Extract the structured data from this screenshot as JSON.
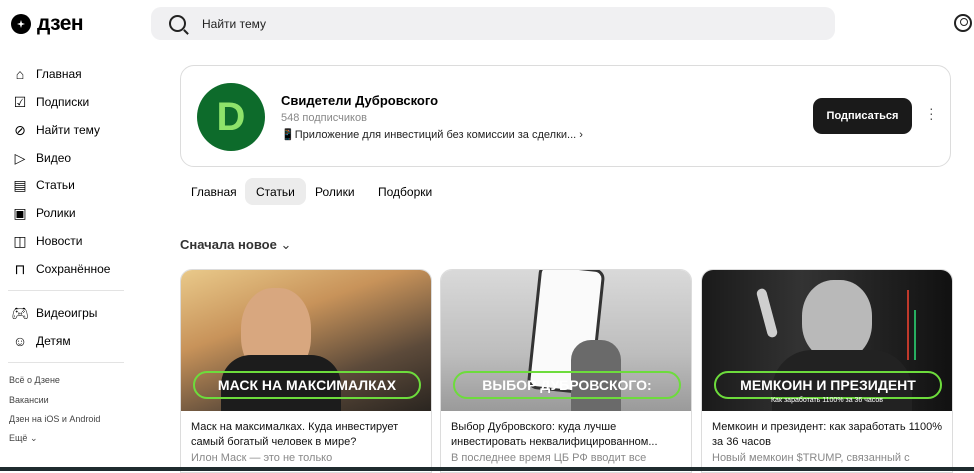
{
  "header": {
    "logo_text": "дзен",
    "search_placeholder": "Найти тему"
  },
  "sidebar": {
    "items": [
      {
        "label": "Главная",
        "icon": "home-icon"
      },
      {
        "label": "Подписки",
        "icon": "subscriptions-icon"
      },
      {
        "label": "Найти тему",
        "icon": "find-topic-icon"
      },
      {
        "label": "Видео",
        "icon": "video-icon"
      },
      {
        "label": "Статьи",
        "icon": "articles-icon"
      },
      {
        "label": "Ролики",
        "icon": "shorts-icon"
      },
      {
        "label": "Новости",
        "icon": "news-icon"
      },
      {
        "label": "Сохранённое",
        "icon": "bookmark-icon"
      }
    ],
    "extra_items": [
      {
        "label": "Видеоигры",
        "icon": "gamepad-icon"
      },
      {
        "label": "Детям",
        "icon": "kids-icon"
      }
    ],
    "footer_links": [
      "Всё о Дзене",
      "Вакансии",
      "Дзен на iOS и Android",
      "Ещё"
    ]
  },
  "channel": {
    "title": "Свидетели Дубровского",
    "subscribers": "548 подписчиков",
    "description": "📱Приложение для инвестиций без комиссии за сделки...",
    "subscribe_label": "Подписаться",
    "avatar_letter": "D"
  },
  "tabs": [
    "Главная",
    "Статьи",
    "Ролики",
    "Подборки"
  ],
  "active_tab": "Статьи",
  "sort_label": "Сначала новое",
  "cards": [
    {
      "badge": "МАСК НА МАКСИМАЛКАХ",
      "title": "Маск на максималках. Куда инвестирует самый богатый человек в мире?",
      "snippet": "Илон Маск — это не только"
    },
    {
      "badge": "ВЫБОР ДУБРОВСКОГО:",
      "title": "Выбор Дубровского: куда лучше инвестировать неквалифицированном...",
      "snippet": "В последнее время ЦБ РФ вводит все"
    },
    {
      "badge": "МЕМКОИН И ПРЕЗИДЕНТ",
      "title": "Мемкоин и президент: как заработать 1100% за 36 часов",
      "snippet": "Новый мемкоин $TRUMP, связанный с",
      "subcaption": "Как заработать 1100% за 36 часов"
    }
  ],
  "colors": {
    "accent_green": "#6ddc3c",
    "dark_button": "#1a1a1a",
    "avatar_bg": "#0d6b2b"
  }
}
